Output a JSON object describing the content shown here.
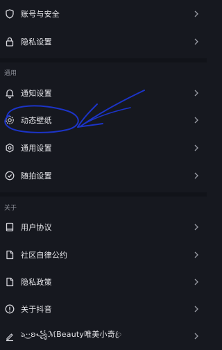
{
  "menu_account": {
    "items": [
      {
        "label": "账号与安全",
        "icon": "shield-icon"
      },
      {
        "label": "隐私设置",
        "icon": "lock-icon"
      }
    ]
  },
  "section_general": {
    "title": "通用",
    "items": [
      {
        "label": "通知设置",
        "icon": "bell-icon"
      },
      {
        "label": "动态壁纸",
        "icon": "gear-icon"
      },
      {
        "label": "通用设置",
        "icon": "settings-icon"
      },
      {
        "label": "随拍设置",
        "icon": "check-circle-icon"
      }
    ]
  },
  "section_about": {
    "title": "关于",
    "items": [
      {
        "label": "用户协议",
        "icon": "book-icon"
      },
      {
        "label": "社区自律公约",
        "icon": "document-icon"
      },
      {
        "label": "隐私政策",
        "icon": "document-icon"
      },
      {
        "label": "关于抖音",
        "icon": "info-icon"
      },
      {
        "label": "ঌ·͜·ʚ꧁ℳBeauty唯美小奇ꦿ",
        "icon": "edit-icon"
      }
    ]
  },
  "colors": {
    "background": "#16181f",
    "text": "#e8e8ec",
    "muted": "#8a8d96",
    "annotation": "#1c34c8"
  }
}
